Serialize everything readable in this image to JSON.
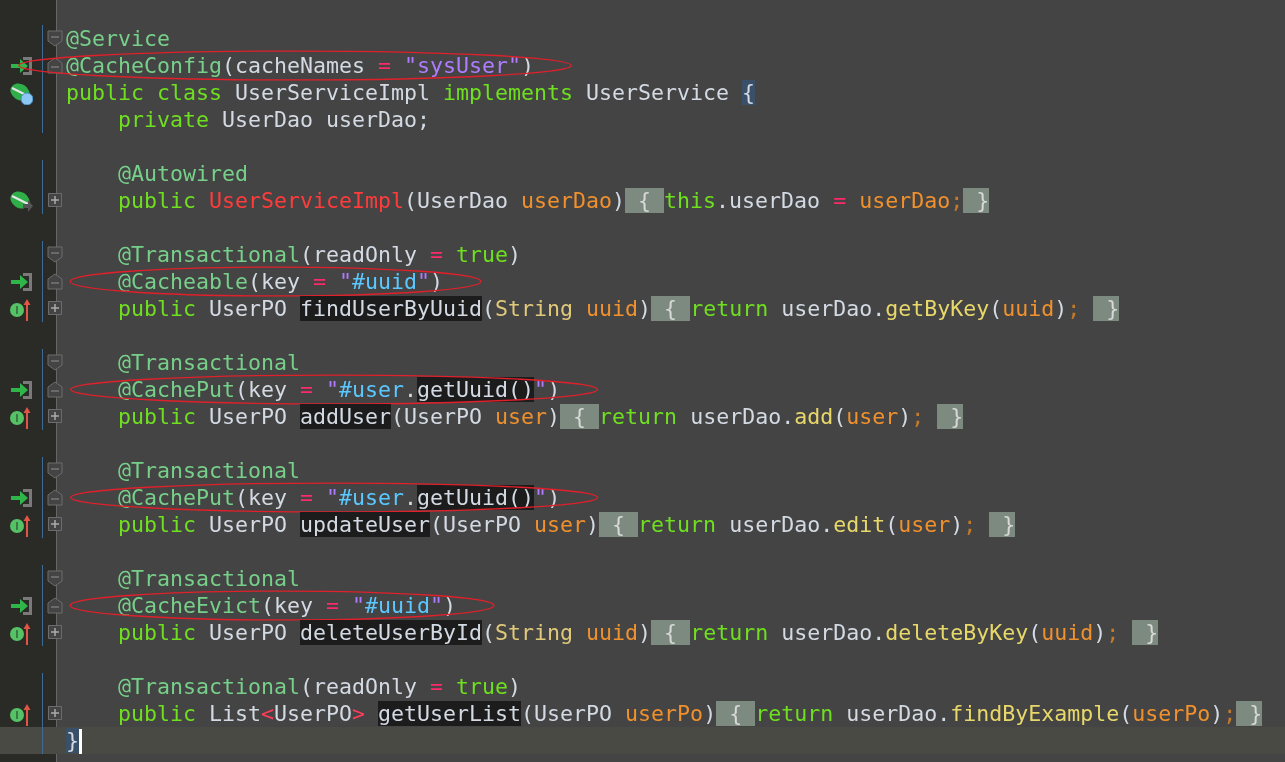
{
  "editor": {
    "lines": [
      {
        "fold": {
          "kind": "start"
        },
        "tokens": [
          {
            "text": "@Service",
            "kind": "annotation"
          }
        ]
      },
      {
        "gutter_icon": {
          "kind": "implement"
        },
        "fold": {
          "kind": "end"
        },
        "circled": true,
        "tokens": [
          {
            "text": "@CacheConfig",
            "kind": "annotation"
          },
          {
            "text": "(cacheNames ",
            "kind": "plain"
          },
          {
            "text": "=",
            "kind": "operator"
          },
          {
            "text": " \"sysUser\"",
            "kind": "string"
          },
          {
            "text": ")",
            "kind": "plain"
          }
        ]
      },
      {
        "gutter_icon": {
          "kind": "bean"
        },
        "tokens": [
          {
            "text": "public class ",
            "kind": "keyword"
          },
          {
            "text": "UserServiceImpl ",
            "kind": "plain"
          },
          {
            "text": "implements ",
            "kind": "keyword"
          },
          {
            "text": "UserService ",
            "kind": "plain"
          },
          {
            "text": "{",
            "kind": "plain",
            "brace_match": true
          }
        ]
      },
      {
        "indented": true,
        "tokens": [
          {
            "text": "private ",
            "kind": "keyword"
          },
          {
            "text": "UserDao userDao;",
            "kind": "plain"
          }
        ]
      },
      {
        "indented": true,
        "gap_before": true,
        "tokens": [
          {
            "text": "@Autowired",
            "kind": "annotation"
          }
        ]
      },
      {
        "indented": true,
        "gutter_icon": {
          "kind": "bean-arrow"
        },
        "fold": {
          "kind": "collapsed"
        },
        "tokens": [
          {
            "text": "public ",
            "kind": "keyword"
          },
          {
            "text": "UserServiceImpl",
            "kind": "constructor"
          },
          {
            "text": "(UserDao ",
            "kind": "plain"
          },
          {
            "text": "userDao",
            "kind": "param"
          },
          {
            "text": ")",
            "kind": "plain"
          },
          {
            "text": " { ",
            "kind": "fold"
          },
          {
            "text": "this",
            "kind": "keyword"
          },
          {
            "text": ".userDao ",
            "kind": "plain"
          },
          {
            "text": "=",
            "kind": "operator"
          },
          {
            "text": " userDao",
            "kind": "param"
          },
          {
            "text": ";",
            "kind": "semi"
          },
          {
            "text": " }",
            "kind": "fold"
          }
        ]
      },
      {
        "indented": true,
        "gap_before": true,
        "fold": {
          "kind": "start"
        },
        "tokens": [
          {
            "text": "@Transactional",
            "kind": "annotation"
          },
          {
            "text": "(readOnly ",
            "kind": "plain"
          },
          {
            "text": "=",
            "kind": "operator"
          },
          {
            "text": " true",
            "kind": "keyword"
          },
          {
            "text": ")",
            "kind": "plain"
          }
        ]
      },
      {
        "indented": true,
        "gutter_icon": {
          "kind": "implement"
        },
        "fold": {
          "kind": "end"
        },
        "circled": true,
        "tokens": [
          {
            "text": "@Cacheable",
            "kind": "annotation"
          },
          {
            "text": "(key ",
            "kind": "plain"
          },
          {
            "text": "=",
            "kind": "operator"
          },
          {
            "text": " \"",
            "kind": "string"
          },
          {
            "text": "#uuid",
            "kind": "spel"
          },
          {
            "text": "\"",
            "kind": "string"
          },
          {
            "text": ")",
            "kind": "plain"
          }
        ]
      },
      {
        "indented": true,
        "gutter_icon": {
          "kind": "override"
        },
        "fold": {
          "kind": "collapsed"
        },
        "tokens": [
          {
            "text": "public ",
            "kind": "keyword"
          },
          {
            "text": "UserPO ",
            "kind": "plain"
          },
          {
            "text": "findUserByUuid",
            "kind": "plain",
            "usage": true
          },
          {
            "text": "(",
            "kind": "plain"
          },
          {
            "text": "String ",
            "kind": "class"
          },
          {
            "text": "uuid",
            "kind": "param"
          },
          {
            "text": ")",
            "kind": "plain"
          },
          {
            "text": " { ",
            "kind": "fold"
          },
          {
            "text": "return ",
            "kind": "keyword"
          },
          {
            "text": "userDao.",
            "kind": "plain"
          },
          {
            "text": "getByKey",
            "kind": "call"
          },
          {
            "text": "(",
            "kind": "plain"
          },
          {
            "text": "uuid",
            "kind": "param"
          },
          {
            "text": ")",
            "kind": "plain"
          },
          {
            "text": "; ",
            "kind": "semi"
          },
          {
            "text": " }",
            "kind": "fold"
          }
        ]
      },
      {
        "indented": true,
        "gap_before": true,
        "fold": {
          "kind": "start"
        },
        "tokens": [
          {
            "text": "@Transactional",
            "kind": "annotation"
          }
        ]
      },
      {
        "indented": true,
        "gutter_icon": {
          "kind": "implement"
        },
        "fold": {
          "kind": "end"
        },
        "circled": true,
        "tokens": [
          {
            "text": "@CachePut",
            "kind": "annotation"
          },
          {
            "text": "(key ",
            "kind": "plain"
          },
          {
            "text": "=",
            "kind": "operator"
          },
          {
            "text": " \"",
            "kind": "string"
          },
          {
            "text": "#user",
            "kind": "spel"
          },
          {
            "text": ".",
            "kind": "plain"
          },
          {
            "text": "getUuid()",
            "kind": "plain",
            "usage": true
          },
          {
            "text": "\"",
            "kind": "string"
          },
          {
            "text": ")",
            "kind": "plain"
          }
        ]
      },
      {
        "indented": true,
        "gutter_icon": {
          "kind": "override"
        },
        "fold": {
          "kind": "collapsed"
        },
        "tokens": [
          {
            "text": "public ",
            "kind": "keyword"
          },
          {
            "text": "UserPO ",
            "kind": "plain"
          },
          {
            "text": "addUser",
            "kind": "plain",
            "usage": true
          },
          {
            "text": "(UserPO ",
            "kind": "plain"
          },
          {
            "text": "user",
            "kind": "param"
          },
          {
            "text": ")",
            "kind": "plain"
          },
          {
            "text": " { ",
            "kind": "fold"
          },
          {
            "text": "return ",
            "kind": "keyword"
          },
          {
            "text": "userDao.",
            "kind": "plain"
          },
          {
            "text": "add",
            "kind": "call"
          },
          {
            "text": "(",
            "kind": "plain"
          },
          {
            "text": "user",
            "kind": "param"
          },
          {
            "text": ")",
            "kind": "plain"
          },
          {
            "text": "; ",
            "kind": "semi"
          },
          {
            "text": " }",
            "kind": "fold"
          }
        ]
      },
      {
        "indented": true,
        "gap_before": true,
        "fold": {
          "kind": "start"
        },
        "tokens": [
          {
            "text": "@Transactional",
            "kind": "annotation"
          }
        ]
      },
      {
        "indented": true,
        "gutter_icon": {
          "kind": "implement"
        },
        "fold": {
          "kind": "end"
        },
        "circled": true,
        "tokens": [
          {
            "text": "@CachePut",
            "kind": "annotation"
          },
          {
            "text": "(key ",
            "kind": "plain"
          },
          {
            "text": "=",
            "kind": "operator"
          },
          {
            "text": " \"",
            "kind": "string"
          },
          {
            "text": "#user",
            "kind": "spel"
          },
          {
            "text": ".",
            "kind": "plain"
          },
          {
            "text": "getUuid()",
            "kind": "plain",
            "usage": true
          },
          {
            "text": "\"",
            "kind": "string"
          },
          {
            "text": ")",
            "kind": "plain"
          }
        ]
      },
      {
        "indented": true,
        "gutter_icon": {
          "kind": "override"
        },
        "fold": {
          "kind": "collapsed"
        },
        "tokens": [
          {
            "text": "public ",
            "kind": "keyword"
          },
          {
            "text": "UserPO ",
            "kind": "plain"
          },
          {
            "text": "updateUser",
            "kind": "plain",
            "usage": true
          },
          {
            "text": "(UserPO ",
            "kind": "plain"
          },
          {
            "text": "user",
            "kind": "param"
          },
          {
            "text": ")",
            "kind": "plain"
          },
          {
            "text": " { ",
            "kind": "fold"
          },
          {
            "text": "return ",
            "kind": "keyword"
          },
          {
            "text": "userDao.",
            "kind": "plain"
          },
          {
            "text": "edit",
            "kind": "call"
          },
          {
            "text": "(",
            "kind": "plain"
          },
          {
            "text": "user",
            "kind": "param"
          },
          {
            "text": ")",
            "kind": "plain"
          },
          {
            "text": "; ",
            "kind": "semi"
          },
          {
            "text": " }",
            "kind": "fold"
          }
        ]
      },
      {
        "indented": true,
        "gap_before": true,
        "fold": {
          "kind": "start"
        },
        "tokens": [
          {
            "text": "@Transactional",
            "kind": "annotation"
          }
        ]
      },
      {
        "indented": true,
        "gutter_icon": {
          "kind": "implement"
        },
        "fold": {
          "kind": "end"
        },
        "circled": true,
        "tokens": [
          {
            "text": "@CacheEvict",
            "kind": "annotation"
          },
          {
            "text": "(key ",
            "kind": "plain"
          },
          {
            "text": "=",
            "kind": "operator"
          },
          {
            "text": " \"",
            "kind": "string"
          },
          {
            "text": "#uuid",
            "kind": "spel"
          },
          {
            "text": "\"",
            "kind": "string"
          },
          {
            "text": ")",
            "kind": "plain"
          }
        ]
      },
      {
        "indented": true,
        "gutter_icon": {
          "kind": "override"
        },
        "fold": {
          "kind": "collapsed"
        },
        "tokens": [
          {
            "text": "public ",
            "kind": "keyword"
          },
          {
            "text": "UserPO ",
            "kind": "plain"
          },
          {
            "text": "deleteUserById",
            "kind": "plain",
            "usage": true
          },
          {
            "text": "(",
            "kind": "plain"
          },
          {
            "text": "String ",
            "kind": "class"
          },
          {
            "text": "uuid",
            "kind": "param"
          },
          {
            "text": ")",
            "kind": "plain"
          },
          {
            "text": " { ",
            "kind": "fold"
          },
          {
            "text": "return ",
            "kind": "keyword"
          },
          {
            "text": "userDao.",
            "kind": "plain"
          },
          {
            "text": "deleteByKey",
            "kind": "call"
          },
          {
            "text": "(",
            "kind": "plain"
          },
          {
            "text": "uuid",
            "kind": "param"
          },
          {
            "text": ")",
            "kind": "plain"
          },
          {
            "text": "; ",
            "kind": "semi"
          },
          {
            "text": " }",
            "kind": "fold"
          }
        ]
      },
      {
        "indented": true,
        "gap_before": true,
        "tokens": [
          {
            "text": "@Transactional",
            "kind": "annotation"
          },
          {
            "text": "(readOnly ",
            "kind": "plain"
          },
          {
            "text": "=",
            "kind": "operator"
          },
          {
            "text": " true",
            "kind": "keyword"
          },
          {
            "text": ")",
            "kind": "plain"
          }
        ]
      },
      {
        "indented": true,
        "gutter_icon": {
          "kind": "override"
        },
        "fold": {
          "kind": "collapsed"
        },
        "tokens": [
          {
            "text": "public ",
            "kind": "keyword"
          },
          {
            "text": "List",
            "kind": "plain"
          },
          {
            "text": "<",
            "kind": "generic"
          },
          {
            "text": "UserPO",
            "kind": "plain"
          },
          {
            "text": "> ",
            "kind": "generic"
          },
          {
            "text": "getUserList",
            "kind": "plain",
            "usage": true
          },
          {
            "text": "(UserPO ",
            "kind": "plain"
          },
          {
            "text": "userPo",
            "kind": "param"
          },
          {
            "text": ")",
            "kind": "plain"
          },
          {
            "text": " { ",
            "kind": "fold"
          },
          {
            "text": "return ",
            "kind": "keyword"
          },
          {
            "text": "userDao.",
            "kind": "plain"
          },
          {
            "text": "findByExample",
            "kind": "call"
          },
          {
            "text": "(",
            "kind": "plain"
          },
          {
            "text": "userPo",
            "kind": "param"
          },
          {
            "text": ")",
            "kind": "plain"
          },
          {
            "text": ";",
            "kind": "semi"
          },
          {
            "text": " }",
            "kind": "fold"
          }
        ]
      },
      {
        "current": true,
        "tokens": [
          {
            "text": "}",
            "kind": "plain",
            "brace_match": true
          }
        ]
      }
    ]
  }
}
